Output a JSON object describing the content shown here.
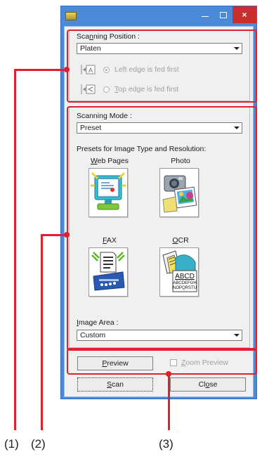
{
  "window": {
    "title": "",
    "controls": {
      "minimize": "–",
      "maximize": "□",
      "close": "×"
    }
  },
  "scanning_position": {
    "label_pre": "Sca",
    "label_key": "n",
    "label_post": "ning Position :",
    "value": "Platen",
    "options": [
      {
        "label": "Left edge is fed first",
        "selected": true,
        "enabled": false
      },
      {
        "label_key": "T",
        "label_post": "op edge is fed first",
        "selected": false,
        "enabled": false
      }
    ]
  },
  "scanning_mode": {
    "label": "Scanning Mode :",
    "value": "Preset",
    "presets_label": "Presets for Image Type and Resolution:",
    "presets": [
      {
        "key": "W",
        "rest": "eb Pages",
        "icon": "web-pages-icon"
      },
      {
        "key": "",
        "rest": "Photo",
        "icon": "photo-icon"
      },
      {
        "key": "F",
        "rest": "AX",
        "icon": "fax-icon"
      },
      {
        "key": "O",
        "rest": "CR",
        "icon": "ocr-icon",
        "sample_text": [
          "ABCD",
          "ABCDEFGH",
          "NOPQRSTU"
        ]
      }
    ],
    "image_area_label_pre": "",
    "image_area_key": "I",
    "image_area_label_post": "mage Area :",
    "image_area_value": "Custom"
  },
  "preview_bar": {
    "preview_key": "P",
    "preview_rest": "review",
    "zoom_key": "Z",
    "zoom_rest": "oom Preview",
    "zoom_checked": false,
    "zoom_enabled": false
  },
  "footer": {
    "scan_key": "S",
    "scan_rest": "can",
    "close_pre": "Cl",
    "close_key": "o",
    "close_post": "se"
  },
  "callouts": {
    "one": "(1)",
    "two": "(2)",
    "three": "(3)"
  },
  "colors": {
    "accent": "#4a8ad8",
    "callout": "#e0202c",
    "close_button": "#c9302c"
  }
}
